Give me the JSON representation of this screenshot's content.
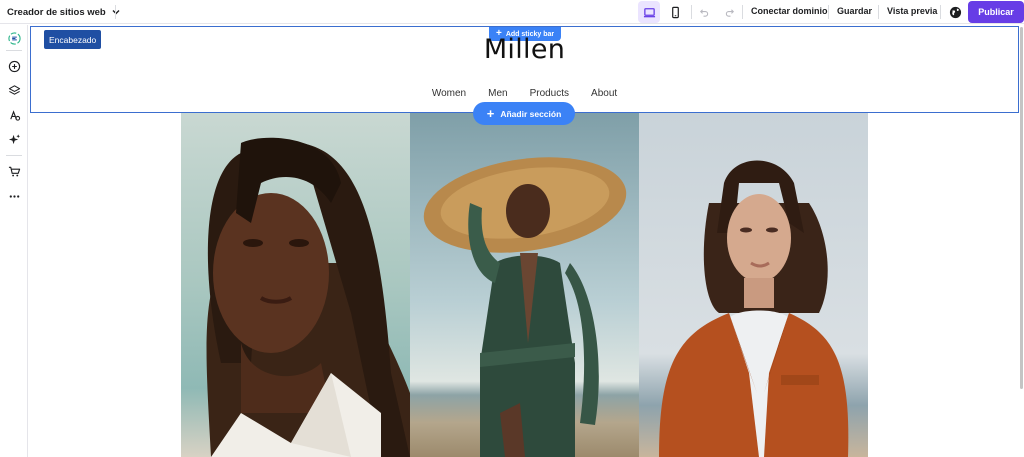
{
  "topbar": {
    "site_menu_label": "Creador de sitios web",
    "connect_domain": "Conectar dominio",
    "save": "Guardar",
    "preview": "Vista previa",
    "publish": "Publicar"
  },
  "canvas": {
    "header_badge": "Encabezado",
    "sticky_bar_label": "Add sticky bar",
    "logo": "Millen",
    "nav": [
      "Women",
      "Men",
      "Products",
      "About"
    ],
    "add_section_label": "Añadir sección"
  },
  "colors": {
    "accent": "#673de6",
    "editor_blue": "#3b82f6",
    "badge_blue": "#1f4fa3"
  },
  "icons": [
    "chevron-down-icon",
    "desktop-icon",
    "mobile-icon",
    "undo-icon",
    "redo-icon",
    "globe-icon",
    "logo-icon",
    "add-element-icon",
    "layers-icon",
    "styles-icon",
    "ai-tools-icon",
    "store-icon",
    "more-icon"
  ]
}
